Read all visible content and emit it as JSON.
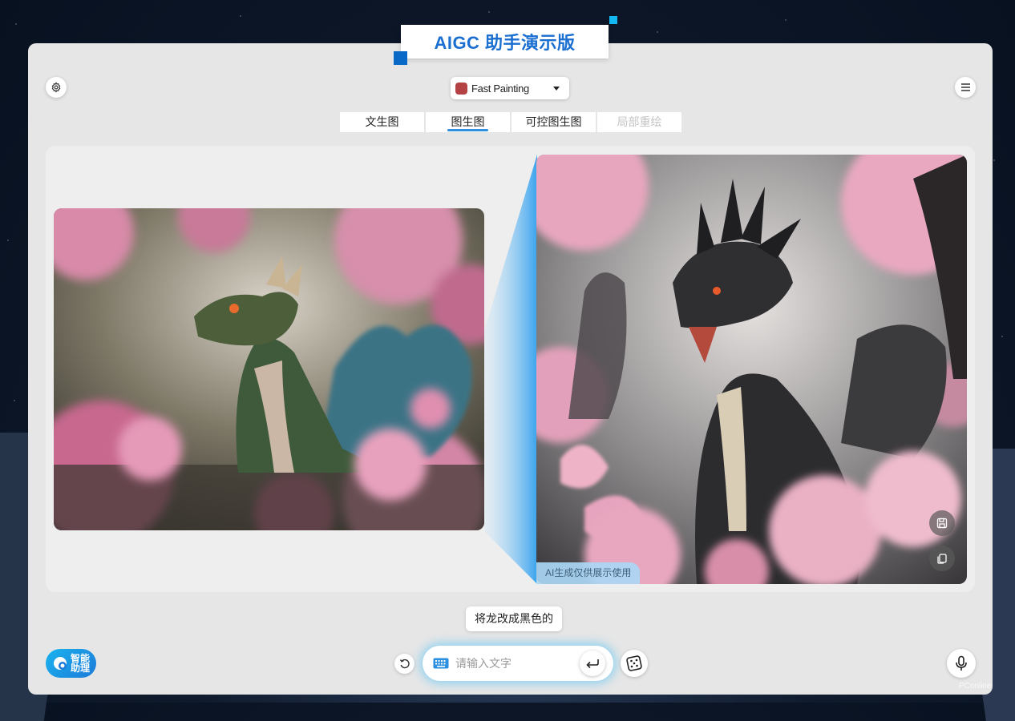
{
  "app": {
    "title": "AIGC 助手演示版"
  },
  "model": {
    "selected": "Fast Painting",
    "color": "#b44245"
  },
  "tabs": [
    {
      "label": "文生图",
      "state": "normal"
    },
    {
      "label": "图生图",
      "state": "active"
    },
    {
      "label": "可控图生图",
      "state": "normal"
    },
    {
      "label": "局部重绘",
      "state": "disabled"
    }
  ],
  "output": {
    "watermark": "AI生成仅供展示使用"
  },
  "prompt": {
    "last": "将龙改成黑色的"
  },
  "assistant": {
    "label": "智能助理"
  },
  "input": {
    "placeholder": "请输入文字"
  },
  "icons": [
    "gear-icon",
    "hamburger-menu-icon",
    "save-icon",
    "copy-icon",
    "refresh-icon",
    "keyboard-icon",
    "enter-icon",
    "dice-icon",
    "microphone-icon"
  ],
  "colors": {
    "accent": "#1a6fd0",
    "tab_underline": "#2f8fe0",
    "panel": "#e6e6e6"
  },
  "footer": {
    "mark": "PConline"
  }
}
